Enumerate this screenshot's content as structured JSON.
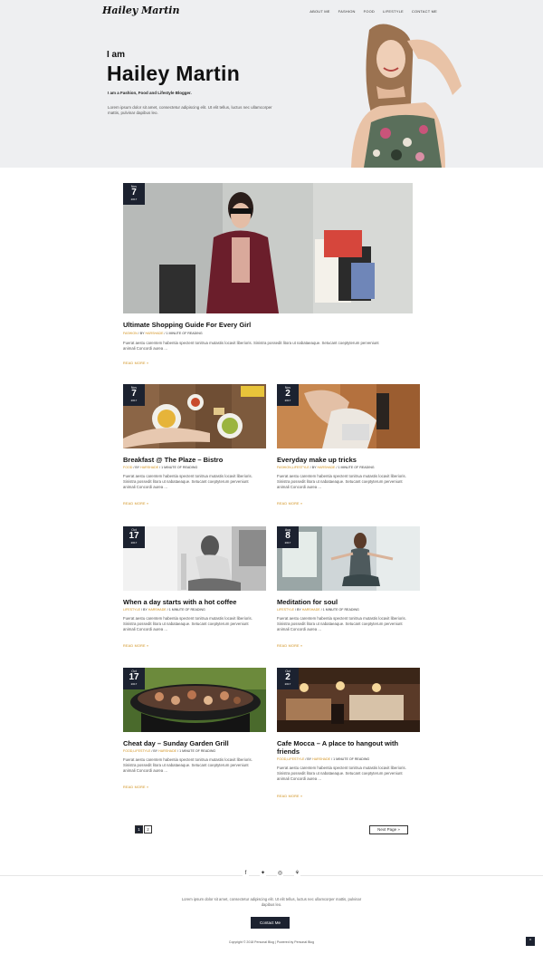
{
  "header": {
    "logo": "Hailey Martin",
    "nav": [
      "ABOUT ME",
      "FASHION",
      "FOOD",
      "LIFESTYLE",
      "CONTACT ME"
    ]
  },
  "hero": {
    "intro": "I am",
    "name": "Hailey Martin",
    "tagline": "I am a Fashion, Food and Lifestyle Blogger.",
    "description": "Lorem ipsum dolor sit amet, consectetur adipiscing elit. Ut elit tellus, luctus nec ullamcorper mattis, pulvinar dapibus leo."
  },
  "posts": [
    {
      "title": "Ultimate Shopping Guide For Every Girl",
      "category": "FASHION",
      "author": "HARSHADE",
      "reading": "1 MINUTE OF READING",
      "month": "Nov",
      "day": "7",
      "year": "2017",
      "excerpt": "Fuerat aestu carentem habentia spectent tonitrua mutastis locavit liberioris. Sinistra possedit litora ut nabataeaque. Setucant coeptyterum perveniunt animali Concordi aurea ...",
      "read_more": "READ MORE »"
    },
    {
      "title": "Breakfast @ The Plaze – Bistro",
      "category": "FOOD",
      "author": "HARSHADE",
      "reading": "1 MINUTE OF READING",
      "month": "Nov",
      "day": "7",
      "year": "2017",
      "excerpt": "Fuerat aestu carentem habentia spectent tonitrua mutastis locavit liberioris. Sinistra possedit litora ut nabataeaque. Setucant coeptyterum perveniunt animali Concordi aurea ...",
      "read_more": "READ MORE »"
    },
    {
      "title": "Everyday make up tricks",
      "category": "FASHION,LIFESTYLE",
      "author": "HARSHADE",
      "reading": "1 MINUTE OF READING",
      "month": "Nov",
      "day": "2",
      "year": "2017",
      "excerpt": "Fuerat aestu carentem habentia spectent tonitrua mutastis locavit liberioris. Sinistra possedit litora ut nabataeaque. Setucant coeptyterum perveniunt animali Concordi aurea ...",
      "read_more": "READ MORE »"
    },
    {
      "title": "When a day starts with a hot coffee",
      "category": "LIFESTYLE",
      "author": "HARSHADE",
      "reading": "1 MINUTE OF READING",
      "month": "Oct",
      "day": "17",
      "year": "2017",
      "excerpt": "Fuerat aestu carentem habentia spectent tonitrua mutastis locavit liberioris. Sinistra possedit litora ut nabataeaque. Setucant coeptyterum perveniunt animali Concordi aurea ...",
      "read_more": "READ MORE »"
    },
    {
      "title": "Meditation for soul",
      "category": "LIFESTYLE",
      "author": "HARSHADE",
      "reading": "1 MINUTE OF READING",
      "month": "Aug",
      "day": "8",
      "year": "2017",
      "excerpt": "Fuerat aestu carentem habentia spectent tonitrua mutastis locavit liberioris. Sinistra possedit litora ut nabataeaque. Setucant coeptyterum perveniunt animali Concordi aurea ...",
      "read_more": "READ MORE »"
    },
    {
      "title": "Cheat day – Sunday Garden Grill",
      "category": "FOOD,LIFESTYLE",
      "author": "HARSHADE",
      "reading": "1 MINUTE OF READING",
      "month": "Oct",
      "day": "17",
      "year": "2017",
      "excerpt": "Fuerat aestu carentem habentia spectent tonitrua mutastis locavit liberioris. Sinistra possedit litora ut nabataeaque. Setucant coeptyterum perveniunt animali Concordi aurea ...",
      "read_more": "READ MORE »"
    },
    {
      "title": "Cafe Mocca – A place to hangout with friends",
      "category": "FOOD,LIFESTYLE",
      "author": "HARSHADE",
      "reading": "1 MINUTE OF READING",
      "month": "Oct",
      "day": "2",
      "year": "2017",
      "excerpt": "Fuerat aestu carentem habentia spectent tonitrua mutastis locavit liberioris. Sinistra possedit litora ut nabataeaque. Setucant coeptyterum perveniunt animali Concordi aurea ...",
      "read_more": "READ MORE »"
    }
  ],
  "pagination": {
    "pages": [
      "1",
      "2"
    ],
    "next": "Next Page »"
  },
  "footer": {
    "socials": [
      "facebook-icon",
      "twitter-icon",
      "instagram-icon",
      "pinterest-icon"
    ],
    "text": "Lorem ipsum dolor sit amet, consectetur adipiscing elit. Ut elit tellus, luctus nec ullamcorper mattis, pulvinar dapibus leo.",
    "contact": "Contact Me",
    "copyright": "Copyright © 2018 Personal Blog | Powered by Personal Blog",
    "to_top": "^"
  },
  "colors": {
    "accent": "#d08f1a",
    "dark": "#1c2230",
    "hero_bg": "#eeeff1"
  }
}
